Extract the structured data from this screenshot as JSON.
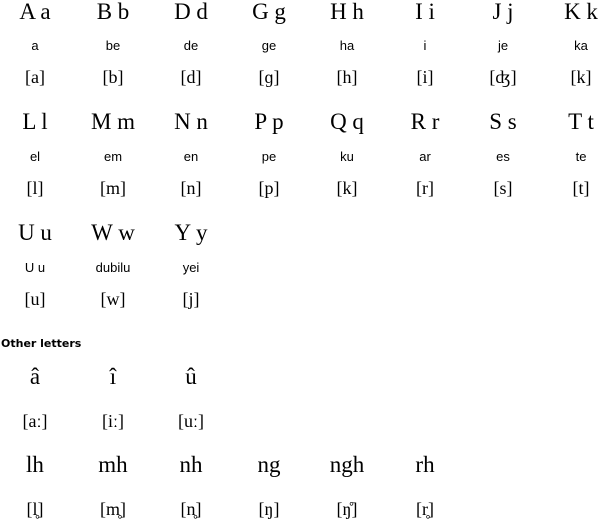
{
  "alphabet": {
    "rows": [
      {
        "letters": [
          "A a",
          "B b",
          "D d",
          "G g",
          "H h",
          "I i",
          "J j",
          "K k"
        ],
        "names": [
          "a",
          "be",
          "de",
          "ge",
          "ha",
          "i",
          "je",
          "ka"
        ],
        "ipa": [
          "[a]",
          "[b]",
          "[d]",
          "[ɡ]",
          "[h]",
          "[i]",
          "[ʤ]",
          "[k]"
        ]
      },
      {
        "letters": [
          "L l",
          "M m",
          "N n",
          "P p",
          "Q q",
          "R r",
          "S s",
          "T t"
        ],
        "names": [
          "el",
          "em",
          "en",
          "pe",
          "ku",
          "ar",
          "es",
          "te"
        ],
        "ipa": [
          "[l]",
          "[m]",
          "[n]",
          "[p]",
          "[k]",
          "[r]",
          "[s]",
          "[t]"
        ]
      },
      {
        "letters": [
          "U u",
          "W w",
          "Y y"
        ],
        "names": [
          "U u",
          "dubilu",
          "yei"
        ],
        "ipa": [
          "[u]",
          "[w]",
          "[j]"
        ]
      }
    ]
  },
  "other_letters": {
    "heading": "Other letters",
    "rows": [
      {
        "letters": [
          "â",
          "î",
          "û"
        ],
        "ipa": [
          "[aː]",
          "[iː]",
          "[uː]"
        ]
      },
      {
        "letters": [
          "lh",
          "mh",
          "nh",
          "ng",
          "ngh",
          "rh"
        ],
        "ipa": [
          "[l̥]",
          "[m̥]",
          "[n̥]",
          "[ŋ]",
          "[ŋ̊]",
          "[r̥]"
        ]
      }
    ]
  }
}
